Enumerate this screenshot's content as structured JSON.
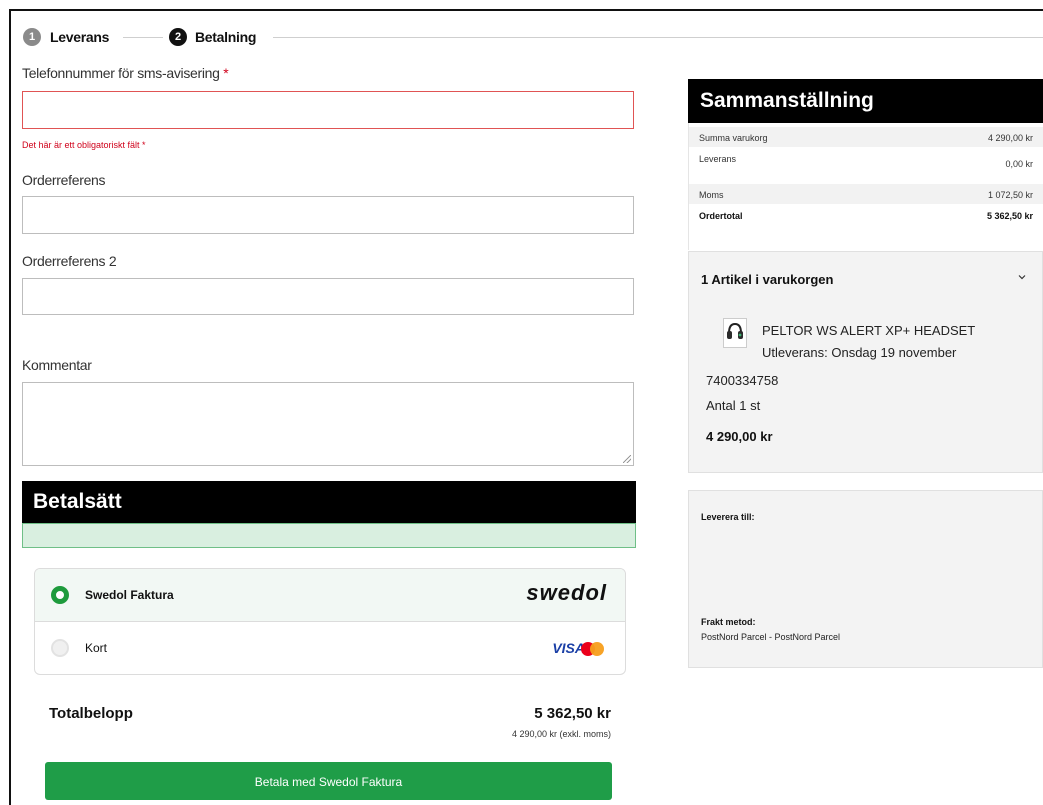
{
  "stepper": {
    "steps": [
      {
        "num": "1",
        "label": "Leverans"
      },
      {
        "num": "2",
        "label": "Betalning"
      }
    ]
  },
  "form": {
    "phone_label": "Telefonnummer för sms-avisering",
    "required_mark": "*",
    "phone_error": "Det här är ett obligatoriskt fält *",
    "orderref_label": "Orderreferens",
    "orderref2_label": "Orderreferens 2",
    "comment_label": "Kommentar"
  },
  "payment": {
    "section_title": "Betalsätt",
    "options": [
      {
        "label": "Swedol Faktura",
        "logo": "swedol",
        "selected": true
      },
      {
        "label": "Kort",
        "logo": "VISA",
        "selected": false
      }
    ],
    "total_label": "Totalbelopp",
    "total_value": "5 362,50 kr",
    "total_excl": "4 290,00 kr (exkl. moms)",
    "pay_button": "Betala med Swedol Faktura"
  },
  "summary": {
    "title": "Sammanställning",
    "rows": [
      {
        "label": "Summa varukorg",
        "value": "4 290,00 kr"
      },
      {
        "label": "Leverans",
        "value": "0,00 kr"
      },
      {
        "label": "Moms",
        "value": "1 072,50 kr"
      },
      {
        "label": "Ordertotal",
        "value": "5 362,50 kr"
      }
    ]
  },
  "cart": {
    "title": "1 Artikel i varukorgen",
    "item": {
      "name": "PELTOR WS ALERT XP+ HEADSET",
      "delivery": "Utleverans: Onsdag 19 november",
      "sku": "7400334758",
      "qty": "Antal 1 st",
      "price": "4 290,00 kr"
    }
  },
  "delivery": {
    "deliver_to_label": "Leverera till:",
    "method_label": "Frakt metod:",
    "method_value": "PostNord Parcel - PostNord Parcel"
  },
  "colors": {
    "accent_green": "#1f9d48",
    "error_red": "#d0021b"
  }
}
